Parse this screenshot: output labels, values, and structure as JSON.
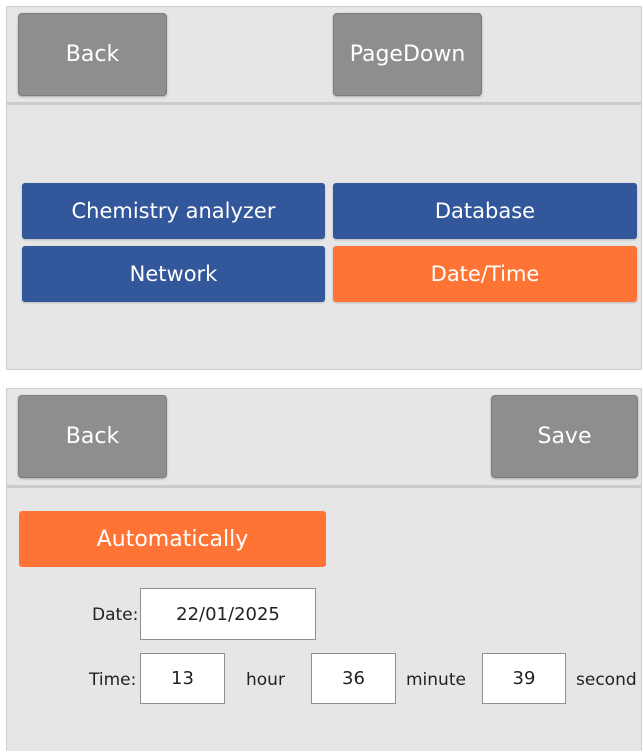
{
  "menu_screen": {
    "toolbar": {
      "back_label": "Back",
      "pagedown_label": "PageDown"
    },
    "items": [
      {
        "label": "Chemistry analyzer",
        "color": "#32579a"
      },
      {
        "label": "Database",
        "color": "#32579a"
      },
      {
        "label": "Network",
        "color": "#32579a"
      },
      {
        "label": "Date/Time",
        "color": "#ff7434",
        "selected": true
      }
    ]
  },
  "datetime_screen": {
    "toolbar": {
      "back_label": "Back",
      "save_label": "Save"
    },
    "automatic_label": "Automatically",
    "date_label": "Date:",
    "date_value": "22/01/2025",
    "time_label": "Time:",
    "hour_value": "13",
    "hour_unit": "hour",
    "minute_value": "36",
    "minute_unit": "minute",
    "second_value": "39",
    "second_unit": "second"
  },
  "colors": {
    "accent": "#ff7434",
    "primary": "#32579a",
    "toolbar_button": "#8e8e8e",
    "panel_bg": "#e6e6e6"
  }
}
